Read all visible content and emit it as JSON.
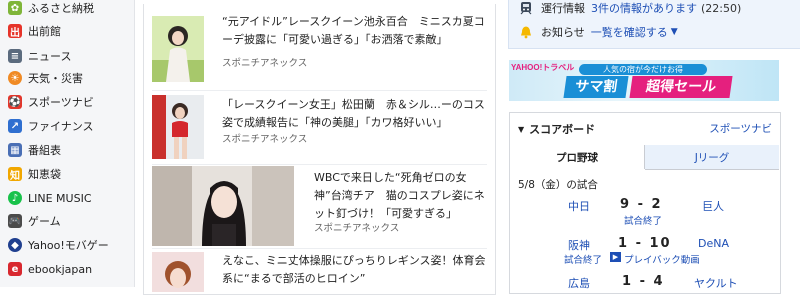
{
  "sidebar": {
    "items": [
      {
        "label": "ふるさと納税",
        "icon": "hometown-tax-icon",
        "color": "#7fb539"
      },
      {
        "label": "出前館",
        "icon": "demaecan-icon",
        "color": "#e6342a"
      },
      {
        "label": "ニュース",
        "icon": "news-icon",
        "color": "#5b6b7e"
      },
      {
        "label": "天気・災害",
        "icon": "weather-icon",
        "color": "#f08a24"
      },
      {
        "label": "スポーツナビ",
        "icon": "sports-icon",
        "color": "#e2362b"
      },
      {
        "label": "ファイナンス",
        "icon": "finance-icon",
        "color": "#2f6fd0"
      },
      {
        "label": "番組表",
        "icon": "tv-guide-icon",
        "color": "#4a6fb5"
      },
      {
        "label": "知恵袋",
        "icon": "chiebukuro-icon",
        "color": "#f1a700"
      },
      {
        "label": "LINE MUSIC",
        "icon": "line-music-icon",
        "color": "#19c24b"
      },
      {
        "label": "ゲーム",
        "icon": "game-icon",
        "color": "#4b4b4b"
      },
      {
        "label": "Yahoo!モバゲー",
        "icon": "mobage-icon",
        "color": "#1f3f8f"
      },
      {
        "label": "ebookjapan",
        "icon": "ebookjapan-icon",
        "color": "#d8282f"
      }
    ]
  },
  "news": {
    "items": [
      {
        "headline": "“元アイドル”レースクイーン池永百合　ミニスカ夏コーデ披露に「可愛い過ぎる」「お洒落で素敵」",
        "source": "スポニチアネックス"
      },
      {
        "headline": "「レースクイーン女王」松田蘭　赤＆シル…ーのコス姿で成績報告に「神の美腿」「カワ格好いい」",
        "source": "スポニチアネックス"
      },
      {
        "headline": "WBCで来日した“死角ゼロの女神”台湾チア　猫のコスプレ姿にネット釘づけ！「可愛すぎる」",
        "source": "スポニチアネックス"
      },
      {
        "headline": "えなこ、ミニ丈体操服にぴっちりレギンス姿！体育会系に“まるで部活のヒロイン”",
        "source": ""
      }
    ]
  },
  "notice": {
    "traffic": {
      "label": "運行情報",
      "text": "3件の情報があります",
      "time": "(22:50)"
    },
    "announcement": {
      "label": "お知らせ",
      "link": "一覧を確認する"
    }
  },
  "banner": {
    "brand": "YAHOO!トラベル",
    "tagline": "人気の宿が今だけお得",
    "title_left": "サマ割",
    "title_right": "超得セール"
  },
  "scoreboard": {
    "title": "スコアボード",
    "link": "スポーツナビ",
    "tabs": [
      {
        "label": "プロ野球",
        "active": true
      },
      {
        "label": "Jリーグ",
        "active": false
      }
    ],
    "date": "5/8（金）の試合",
    "games": [
      {
        "home": "中日",
        "away": "巨人",
        "score": "9 - 2",
        "status": "試合終了",
        "extra": ""
      },
      {
        "home": "阪神",
        "away": "DeNA",
        "score": "1 - 10",
        "status": "試合終了",
        "extra": "プレイバック動画"
      },
      {
        "home": "広島",
        "away": "ヤクルト",
        "score": "1 - 4",
        "status": "",
        "extra": ""
      }
    ]
  },
  "colors": {
    "link": "#1e4fb5",
    "accent_orange": "#f5a623",
    "banner_pink": "#e5207e",
    "banner_blue": "#1a8fd6"
  }
}
